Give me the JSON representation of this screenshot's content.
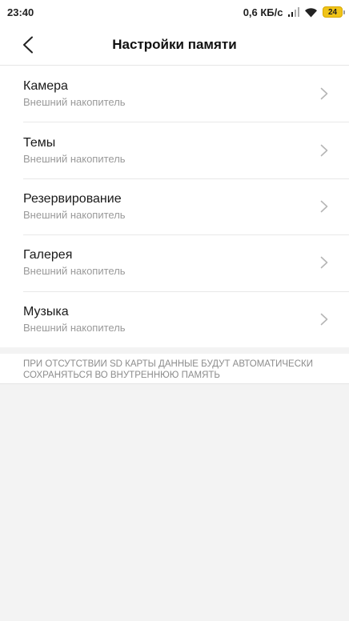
{
  "status_bar": {
    "time": "23:40",
    "network_speed": "0,6 КБ/с",
    "battery_level": "24",
    "battery_color": "#f0c419",
    "icons": [
      "signal-icon",
      "wifi-icon",
      "battery-icon"
    ]
  },
  "header": {
    "title": "Настройки памяти",
    "back_icon": "chevron-left-icon"
  },
  "items": [
    {
      "title": "Камера",
      "subtitle": "Внешний накопитель"
    },
    {
      "title": "Темы",
      "subtitle": "Внешний накопитель"
    },
    {
      "title": "Резервирование",
      "subtitle": "Внешний накопитель"
    },
    {
      "title": "Галерея",
      "subtitle": "Внешний накопитель"
    },
    {
      "title": "Музыка",
      "subtitle": "Внешний накопитель"
    }
  ],
  "note": {
    "text": "ПРИ ОТСУТСТВИИ SD КАРТЫ ДАННЫЕ БУДУТ АВТОМАТИЧЕСКИ СОХРАНЯТЬСЯ ВО ВНУТРЕННЮЮ ПАМЯТЬ"
  }
}
